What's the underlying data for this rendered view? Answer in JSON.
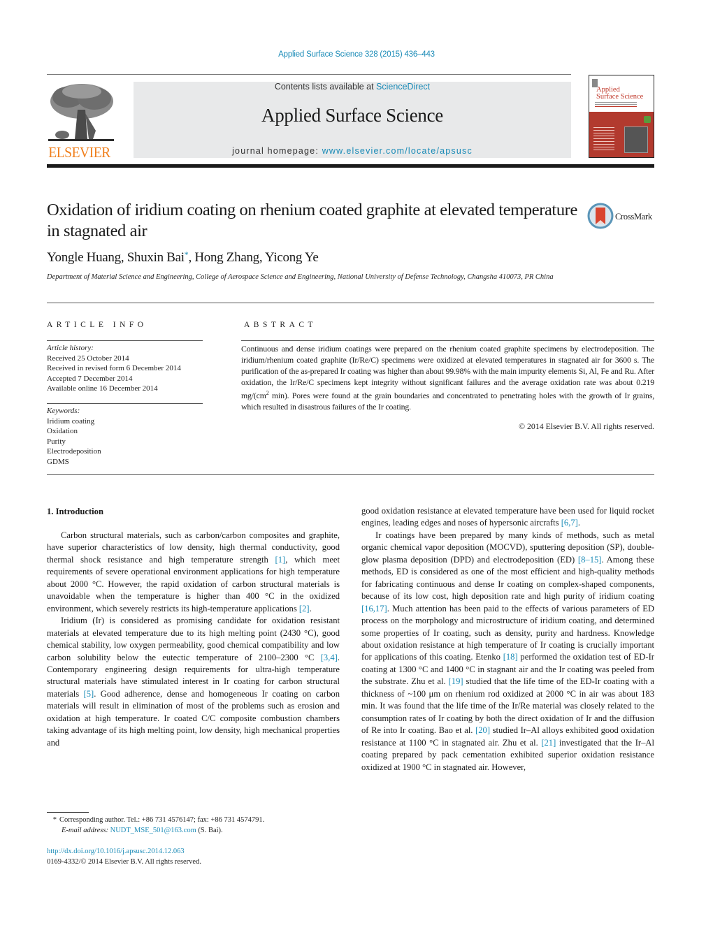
{
  "header": {
    "citation": "Applied Surface Science 328 (2015) 436–443",
    "publisher_wordmark": "ELSEVIER",
    "contents_prefix": "Contents lists available at ",
    "contents_link": "ScienceDirect",
    "journal_name": "Applied Surface Science",
    "homepage_prefix": "journal homepage: ",
    "homepage_link": "www.elsevier.com/locate/apsusc",
    "cover_title_line1": "Applied",
    "cover_title_line2": "Surface Science"
  },
  "article": {
    "title": "Oxidation of iridium coating on rhenium coated graphite at elevated temperature in stagnated air",
    "crossmark_label": "CrossMark",
    "authors": [
      {
        "name": "Yongle Huang",
        "corresponding": false
      },
      {
        "name": "Shuxin Bai",
        "corresponding": true
      },
      {
        "name": "Hong Zhang",
        "corresponding": false
      },
      {
        "name": "Yicong Ye",
        "corresponding": false
      }
    ],
    "author_1": "Yongle Huang, ",
    "author_2": "Shuxin Bai",
    "author_star": "*",
    "author_rest": ", Hong Zhang, Yicong Ye",
    "affiliation": "Department of Material Science and Engineering, College of Aerospace Science and Engineering, National University of Defense Technology, Changsha 410073, PR China"
  },
  "article_info": {
    "heading": "ARTICLE INFO",
    "history_label": "Article history:",
    "history": [
      "Received 25 October 2014",
      "Received in revised form 6 December 2014",
      "Accepted 7 December 2014",
      "Available online 16 December 2014"
    ],
    "keywords_label": "Keywords:",
    "keywords": [
      "Iridium coating",
      "Oxidation",
      "Purity",
      "Electrodeposition",
      "GDMS"
    ]
  },
  "abstract": {
    "heading": "ABSTRACT",
    "text_before_sup": "Continuous and dense iridium coatings were prepared on the rhenium coated graphite specimens by electrodeposition. The iridium/rhenium coated graphite (Ir/Re/C) specimens were oxidized at elevated temperatures in stagnated air for 3600 s. The purification of the as-prepared Ir coating was higher than about 99.98% with the main impurity elements Si, Al, Fe and Ru. After oxidation, the Ir/Re/C specimens kept integrity without significant failures and the average oxidation rate was about 0.219 mg/(cm",
    "sup": "2",
    "text_after_sup": " min). Pores were found at the grain boundaries and concentrated to penetrating holes with the growth of Ir grains, which resulted in disastrous failures of the Ir coating.",
    "copyright": "© 2014 Elsevier B.V. All rights reserved."
  },
  "body": {
    "section_heading": "1.  Introduction",
    "left": {
      "p1_a": "Carbon structural materials, such as carbon/carbon composites and graphite, have superior characteristics of low density, high thermal conductivity, good thermal shock resistance and high temperature strength ",
      "p1_ref1": "[1]",
      "p1_b": ", which meet requirements of severe operational environment applications for high temperature about 2000 °C. However, the rapid oxidation of carbon structural materials is unavoidable when the temperature is higher than 400 °C in the oxidized environment, which severely restricts its high-temperature applications ",
      "p1_ref2": "[2]",
      "p1_c": ".",
      "p2_a": "Iridium (Ir) is considered as promising candidate for oxidation resistant materials at elevated temperature due to its high melting point (2430 °C), good chemical stability, low oxygen permeability, good chemical compatibility and low carbon solubility below the eutectic temperature of 2100–2300 °C ",
      "p2_ref1": "[3,4]",
      "p2_b": ". Contemporary engineering design requirements for ultra-high temperature structural materials have stimulated interest in Ir coating for carbon structural materials ",
      "p2_ref2": "[5]",
      "p2_c": ". Good adherence, dense and homogeneous Ir coating on carbon materials will result in elimination of most of the problems such as erosion and oxidation at high temperature. Ir coated C/C composite combustion chambers taking advantage of its high melting point, low density, high mechanical properties and"
    },
    "right": {
      "p1_a": "good oxidation resistance at elevated temperature have been used for liquid rocket engines, leading edges and noses of hypersonic aircrafts ",
      "p1_ref1": "[6,7]",
      "p1_b": ".",
      "p2_a": "Ir coatings have been prepared by many kinds of methods, such as metal organic chemical vapor deposition (MOCVD), sputtering deposition (SP), double-glow plasma deposition (DPD) and electrodeposition (ED) ",
      "p2_ref1": "[8–15]",
      "p2_b": ". Among these methods, ED is considered as one of the most efficient and high-quality methods for fabricating continuous and dense Ir coating on complex-shaped components, because of its low cost, high deposition rate and high purity of iridium coating ",
      "p2_ref2": "[16,17]",
      "p2_c": ". Much attention has been paid to the effects of various parameters of ED process on the morphology and microstructure of iridium coating, and determined some properties of Ir coating, such as density, purity and hardness. Knowledge about oxidation resistance at high temperature of Ir coating is crucially important for applications of this coating. Etenko ",
      "p2_ref3": "[18]",
      "p2_d": " performed the oxidation test of ED-Ir coating at 1300 °C and 1400 °C in stagnant air and the Ir coating was peeled from the substrate. Zhu et al. ",
      "p2_ref4": "[19]",
      "p2_e": " studied that the life time of the ED-Ir coating with a thickness of ~100 μm on rhenium rod oxidized at 2000 °C in air was about 183 min. It was found that the life time of the Ir/Re material was closely related to the consumption rates of Ir coating by both the direct oxidation of Ir and the diffusion of Re into Ir coating. Bao et al. ",
      "p2_ref5": "[20]",
      "p2_f": " studied Ir–Al alloys exhibited good oxidation resistance at 1100 °C in stagnated air. Zhu et al. ",
      "p2_ref6": "[21]",
      "p2_g": " investigated that the Ir–Al coating prepared by pack cementation exhibited superior oxidation resistance oxidized at 1900 °C in stagnated air. However,"
    }
  },
  "footnote": {
    "star": "*",
    "corresponding": "Corresponding author. Tel.: +86 731 4576147; fax: +86 731 4574791.",
    "email_label": "E-mail address: ",
    "email": "NUDT_MSE_501@163.com",
    "email_suffix": " (S. Bai)."
  },
  "doi": {
    "url": "http://dx.doi.org/10.1016/j.apsusc.2014.12.063",
    "issn_line": "0169-4332/© 2014 Elsevier B.V. All rights reserved."
  }
}
